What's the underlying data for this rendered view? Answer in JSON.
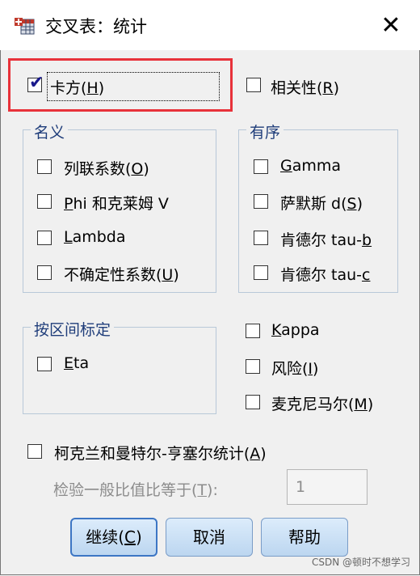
{
  "window": {
    "title": "交叉表：统计",
    "app_icon": "crosstab-table-icon",
    "close_icon": "close-x-icon"
  },
  "top": {
    "chisquare": {
      "label_pre": "卡方(",
      "mnemonic": "H",
      "label_post": ")",
      "checked": true
    },
    "correlations": {
      "label_pre": "相关性(",
      "mnemonic": "R",
      "label_post": ")",
      "checked": false
    }
  },
  "nominal": {
    "title": "名义",
    "items": [
      {
        "pre": "列联系数(",
        "mn": "O",
        "post": ")"
      },
      {
        "pre": "",
        "mn": "P",
        "post": "hi 和克莱姆 V"
      },
      {
        "pre": "",
        "mn": "L",
        "post": "ambda"
      },
      {
        "pre": "不确定性系数(",
        "mn": "U",
        "post": ")"
      }
    ]
  },
  "ordinal": {
    "title": "有序",
    "items": [
      {
        "pre": "",
        "mn": "G",
        "post": "amma"
      },
      {
        "pre": "萨默斯 d(",
        "mn": "S",
        "post": ")"
      },
      {
        "pre": "肯德尔 tau-",
        "mn": "b",
        "post": ""
      },
      {
        "pre": "肯德尔 tau-",
        "mn": "c",
        "post": ""
      }
    ]
  },
  "interval": {
    "title": "按区间标定",
    "items": [
      {
        "pre": "",
        "mn": "E",
        "post": "ta"
      }
    ]
  },
  "other": {
    "items": [
      {
        "pre": "",
        "mn": "K",
        "post": "appa"
      },
      {
        "pre": "风险(",
        "mn": "I",
        "post": ")"
      },
      {
        "pre": "麦克尼马尔(",
        "mn": "M",
        "post": ")"
      }
    ]
  },
  "cmh": {
    "pre": "柯克兰和曼特尔-亨塞尔统计(",
    "mn": "A",
    "post": ")",
    "test_pre": "检验一般比值比等于(",
    "test_mn": "T",
    "test_post": "):",
    "test_value": "1"
  },
  "buttons": {
    "continue": {
      "pre": "继续(",
      "mn": "C",
      "post": ")"
    },
    "cancel": "取消",
    "help": "帮助"
  },
  "watermark": "CSDN @顿时不想学习",
  "colors": {
    "check": "#1a1a8c",
    "highlight_box": "#e8323a",
    "button_border": "#3d76c4"
  }
}
